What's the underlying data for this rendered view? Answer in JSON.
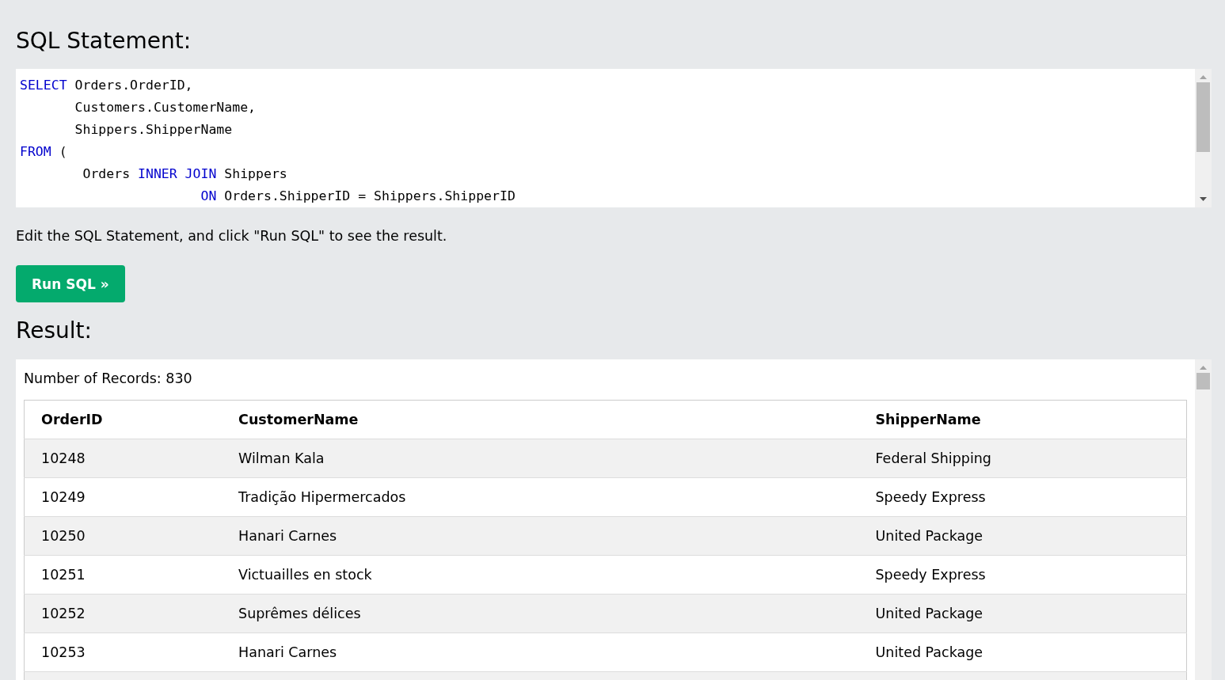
{
  "statement_heading": "SQL Statement:",
  "editor": {
    "lines": [
      [
        {
          "kind": "keyword",
          "text": "SELECT"
        },
        {
          "kind": "plain",
          "text": " Orders.OrderID,"
        }
      ],
      [
        {
          "kind": "plain",
          "text": "       Customers.CustomerName,"
        }
      ],
      [
        {
          "kind": "plain",
          "text": "       Shippers.ShipperName"
        }
      ],
      [
        {
          "kind": "keyword",
          "text": "FROM"
        },
        {
          "kind": "plain",
          "text": " ("
        }
      ],
      [
        {
          "kind": "plain",
          "text": "        Orders "
        },
        {
          "kind": "keyword",
          "text": "INNER JOIN"
        },
        {
          "kind": "plain",
          "text": " Shippers"
        }
      ],
      [
        {
          "kind": "keyword",
          "text": "                       ON"
        },
        {
          "kind": "plain",
          "text": " Orders.ShipperID = Shippers.ShipperID"
        }
      ]
    ]
  },
  "hint": "Edit the SQL Statement, and click \"Run SQL\" to see the result.",
  "run_button": "Run SQL »",
  "result_heading": "Result:",
  "result": {
    "record_count": "Number of Records: 830",
    "table": {
      "columns": [
        "OrderID",
        "CustomerName",
        "ShipperName"
      ],
      "rows": [
        [
          "10248",
          "Wilman Kala",
          "Federal Shipping"
        ],
        [
          "10249",
          "Tradição Hipermercados",
          "Speedy Express"
        ],
        [
          "10250",
          "Hanari Carnes",
          "United Package"
        ],
        [
          "10251",
          "Victuailles en stock",
          "Speedy Express"
        ],
        [
          "10252",
          "Suprêmes délices",
          "United Package"
        ],
        [
          "10253",
          "Hanari Carnes",
          "United Package"
        ]
      ]
    }
  }
}
